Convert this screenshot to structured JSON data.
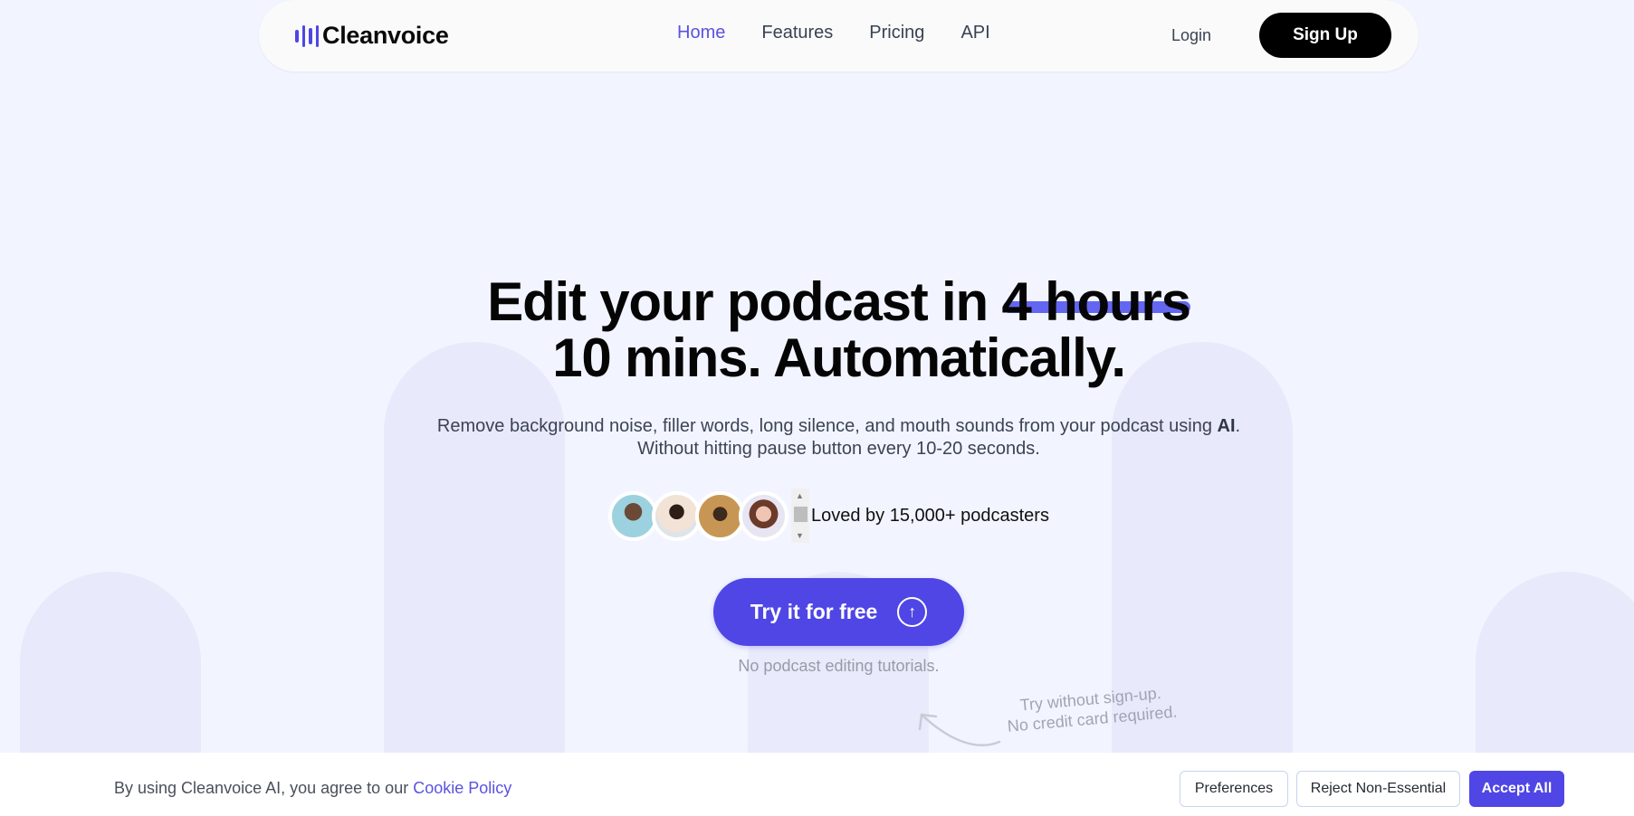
{
  "nav": {
    "brand": "Cleanvoice",
    "links": [
      {
        "label": "Home",
        "active": true
      },
      {
        "label": "Features",
        "active": false
      },
      {
        "label": "Pricing",
        "active": false
      },
      {
        "label": "API",
        "active": false
      }
    ],
    "login": "Login",
    "signup": "Sign Up"
  },
  "hero": {
    "headline_prefix": "Edit your podcast in ",
    "headline_struck": "4 hours",
    "headline_line2": "10 mins. Automatically.",
    "sub_line1_text": "Remove background noise, filler words, long silence, and mouth sounds from your podcast using ",
    "sub_line1_bold": "AI",
    "sub_line1_end": ".",
    "sub_line2": "Without hitting pause button every 10-20 seconds.",
    "social_proof": "Loved by 15,000+ podcasters",
    "avatars": [
      "podcaster-avatar-1",
      "podcaster-avatar-2",
      "podcaster-avatar-3",
      "podcaster-avatar-4"
    ],
    "cta_label": "Try it for free",
    "cta_icon": "arrow-up-circle-icon",
    "cta_note": "No podcast editing tutorials.",
    "try_note_line1": "Try without sign-up.",
    "try_note_line2": "No credit card required."
  },
  "cookie": {
    "text": "By using Cleanvoice AI, you agree to our ",
    "link": "Cookie Policy",
    "preferences": "Preferences",
    "reject": "Reject Non-Essential",
    "accept": "Accept All"
  },
  "colors": {
    "accent": "#4f46e5",
    "background": "#f2f5ff",
    "pillar": "#e8e9fb"
  }
}
